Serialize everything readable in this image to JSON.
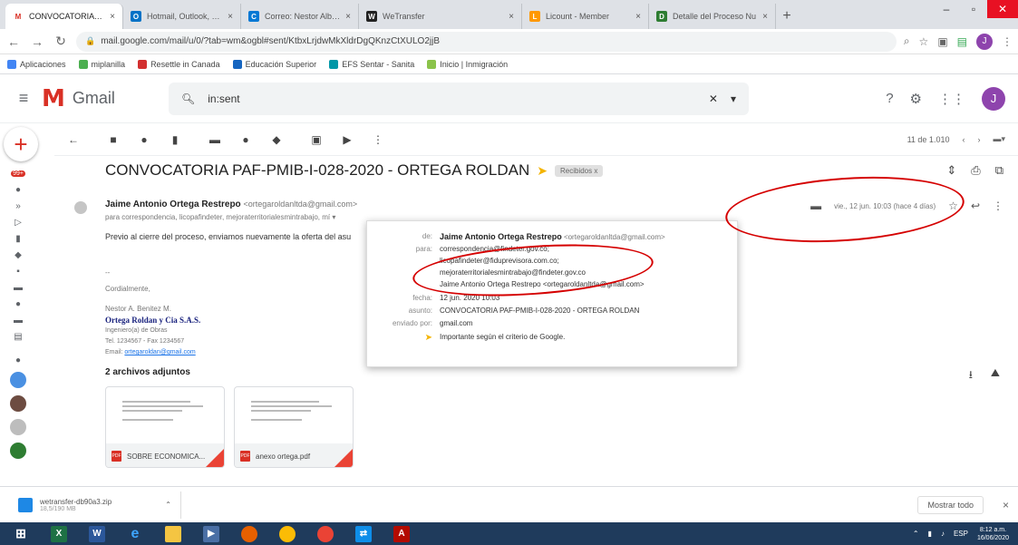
{
  "browser": {
    "tabs": [
      {
        "label": "CONVOCATORIA PAF-P",
        "color": "#d93025",
        "glyph": "M",
        "active": true
      },
      {
        "label": "Hotmail, Outlook, El Tie",
        "color": "#0072c6",
        "glyph": "O"
      },
      {
        "label": "Correo: Nestor Alberto",
        "color": "#0078d4",
        "glyph": "C"
      },
      {
        "label": "WeTransfer",
        "color": "#222222",
        "glyph": "W"
      },
      {
        "label": "Licount - Member",
        "color": "#ff9800",
        "glyph": "L"
      },
      {
        "label": "Detalle del Proceso Nu",
        "color": "#2e7d32",
        "glyph": "D"
      }
    ],
    "close_glyph": "×",
    "newtab_glyph": "+",
    "url": "mail.google.com/mail/u/0/?tab=wm&ogbl#sent/KtbxLrjdwMkXldrDgQKnzCtXULO2jjB",
    "bookmarks": [
      "Aplicaciones",
      "miplanilla",
      "Resettle in Canada",
      "Educación Superior",
      "EFS Sentar - Sanita",
      "Inicio | Inmigración"
    ],
    "user_initial": "J"
  },
  "gmail": {
    "app_name": "Gmail",
    "search_query": "in:sent",
    "avatar_initial": "J",
    "pager_text": "11 de 1.010",
    "rail_badge": "99+"
  },
  "email": {
    "subject": "CONVOCATORIA PAF-PMIB-I-028-2020 - ORTEGA ROLDAN",
    "label_chip": "Recibidos x",
    "sender_name": "Jaime Antonio Ortega Restrepo",
    "sender_email": "<ortegaroldanltda@gmail.com>",
    "recipients": "para correspondencia, licopafindeter, mejoraterritorialesmintrabajo, mí",
    "date": "vie., 12 jun. 10:03 (hace 4 días)",
    "body": "Previo al cierre del proceso, enviamos nuevamente la oferta del asu",
    "signature": {
      "greeting": "Cordialmente,",
      "name": "Nestor A. Benitez M.",
      "company": "Ortega Roldan y Cia S.A.S.",
      "role": "Ingeniero(a) de Obras",
      "phone": "Tel. 1234567 - Fax 1234567",
      "email_label": "Email:",
      "email": "ortegaroldan@gmail.com"
    },
    "attachments_title": "2 archivos adjuntos",
    "attachments": [
      {
        "name": "SOBRE ECONOMICA...",
        "type": "PDF"
      },
      {
        "name": "anexo ortega.pdf",
        "type": "PDF"
      }
    ]
  },
  "details": {
    "from_key": "de:",
    "from_name": "Jaime Antonio Ortega Restrepo",
    "from_email": "<ortegaroldanltda@gmail.com>",
    "to_key": "para:",
    "to_list": [
      "correspondencia@findeter.gov.co;",
      "licopafindeter@fiduprevisora.com.co;",
      "mejoraterritorialesmintrabajo@findeter.gov.co"
    ],
    "to_extra": "Jaime Antonio Ortega Restrepo <ortegaroldanltda@gmail.com>",
    "date_key": "fecha:",
    "date_val": "12 jun. 2020 10:03",
    "subject_key": "asunto:",
    "subject_val": "CONVOCATORIA PAF-PMIB-I-028-2020 - ORTEGA ROLDAN",
    "mailedby_key": "enviado por:",
    "mailedby_val": "gmail.com",
    "importance": "Importante según el criterio de Google."
  },
  "downloads": {
    "file": "wetransfer-db90a3.zip",
    "sub": "18,5/190 MB",
    "show_all": "Mostrar todo",
    "close": "×"
  },
  "taskbar": {
    "time": "8:12 a.m.",
    "date": "16/06/2020",
    "lang": "ESP"
  }
}
